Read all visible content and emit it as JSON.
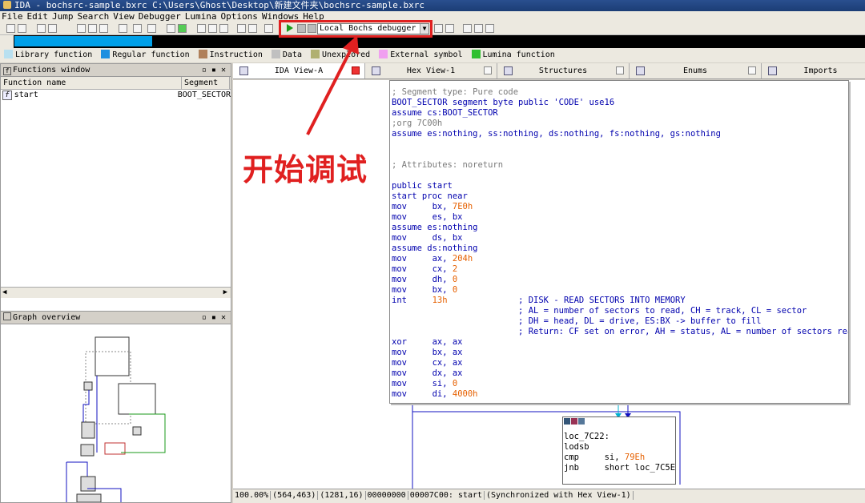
{
  "window": {
    "title": "IDA - bochsrc-sample.bxrc C:\\Users\\Ghost\\Desktop\\新建文件夹\\bochsrc-sample.bxrc"
  },
  "menu": [
    "File",
    "Edit",
    "Jump",
    "Search",
    "View",
    "Debugger",
    "Lumina",
    "Options",
    "Windows",
    "Help"
  ],
  "toolbar": {
    "debugger_select": "Local Bochs debugger",
    "play_icon": "play-icon",
    "highlight_color": "#e02020"
  },
  "legend": [
    {
      "label": "Library function",
      "color": "#b8e0f0"
    },
    {
      "label": "Regular function",
      "color": "#1e90e0"
    },
    {
      "label": "Instruction",
      "color": "#b0805a"
    },
    {
      "label": "Data",
      "color": "#c0c0c0"
    },
    {
      "label": "Unexplored",
      "color": "#b0b070"
    },
    {
      "label": "External symbol",
      "color": "#f0a0f0"
    },
    {
      "label": "Lumina function",
      "color": "#30c030"
    }
  ],
  "functions_window": {
    "title": "Functions window",
    "col_name": "Function name",
    "col_segment": "Segment",
    "rows": [
      {
        "name": "start",
        "segment": "BOOT_SECTOR"
      }
    ]
  },
  "graph_overview": {
    "title": "Graph overview"
  },
  "tabs": [
    {
      "label": "IDA View-A",
      "active": true
    },
    {
      "label": "Hex View-1",
      "active": false
    },
    {
      "label": "Structures",
      "active": false
    },
    {
      "label": "Enums",
      "active": false
    },
    {
      "label": "Imports",
      "active": false
    }
  ],
  "disasm": {
    "l1": "; Segment type: Pure code",
    "l2": "BOOT_SECTOR segment byte public 'CODE' use16",
    "l3": "assume cs:BOOT_SECTOR",
    "l4": ";org 7C00h",
    "l5": "assume es:nothing, ss:nothing, ds:nothing, fs:nothing, gs:nothing",
    "l6": "; Attributes: noreturn",
    "l7": "public start",
    "l8": "start proc near",
    "ins": [
      {
        "m": "mov",
        "a": "bx, ",
        "n": "7E0h"
      },
      {
        "m": "mov",
        "a": "es, bx",
        "n": ""
      },
      {
        "raw": "assume es:nothing"
      },
      {
        "m": "mov",
        "a": "ds, bx",
        "n": ""
      },
      {
        "raw": "assume ds:nothing"
      },
      {
        "m": "mov",
        "a": "ax, ",
        "n": "204h"
      },
      {
        "m": "mov",
        "a": "cx, ",
        "n": "2"
      },
      {
        "m": "mov",
        "a": "dh, ",
        "n": "0"
      },
      {
        "m": "mov",
        "a": "bx, ",
        "n": "0"
      },
      {
        "m": "int",
        "a": "",
        "n": "13h",
        "cm": "; DISK - READ SECTORS INTO MEMORY"
      }
    ],
    "cm2": "; AL = number of sectors to read, CH = track, CL = sector",
    "cm3": "; DH = head, DL = drive, ES:BX -> buffer to fill",
    "cm4": "; Return: CF set on error, AH = status, AL = number of sectors read",
    "ins2": [
      {
        "m": "xor",
        "a": "ax, ax",
        "n": ""
      },
      {
        "m": "mov",
        "a": "bx, ax",
        "n": ""
      },
      {
        "m": "mov",
        "a": "cx, ax",
        "n": ""
      },
      {
        "m": "mov",
        "a": "dx, ax",
        "n": ""
      },
      {
        "m": "mov",
        "a": "si, ",
        "n": "0"
      },
      {
        "m": "mov",
        "a": "di, ",
        "n": "4000h"
      }
    ]
  },
  "block2": {
    "label": "loc_7C22:",
    "l1": "lodsb",
    "m2": "cmp",
    "a2": "si, ",
    "n2": "79Eh",
    "m3": "jnb",
    "a3": "short loc_7C5E"
  },
  "status": [
    "100.00%",
    "(564,463)",
    "(1281,16)",
    "00000000",
    "00007C00: start",
    "(Synchronized with Hex View-1)"
  ],
  "annotation": {
    "text": "开始调试"
  }
}
